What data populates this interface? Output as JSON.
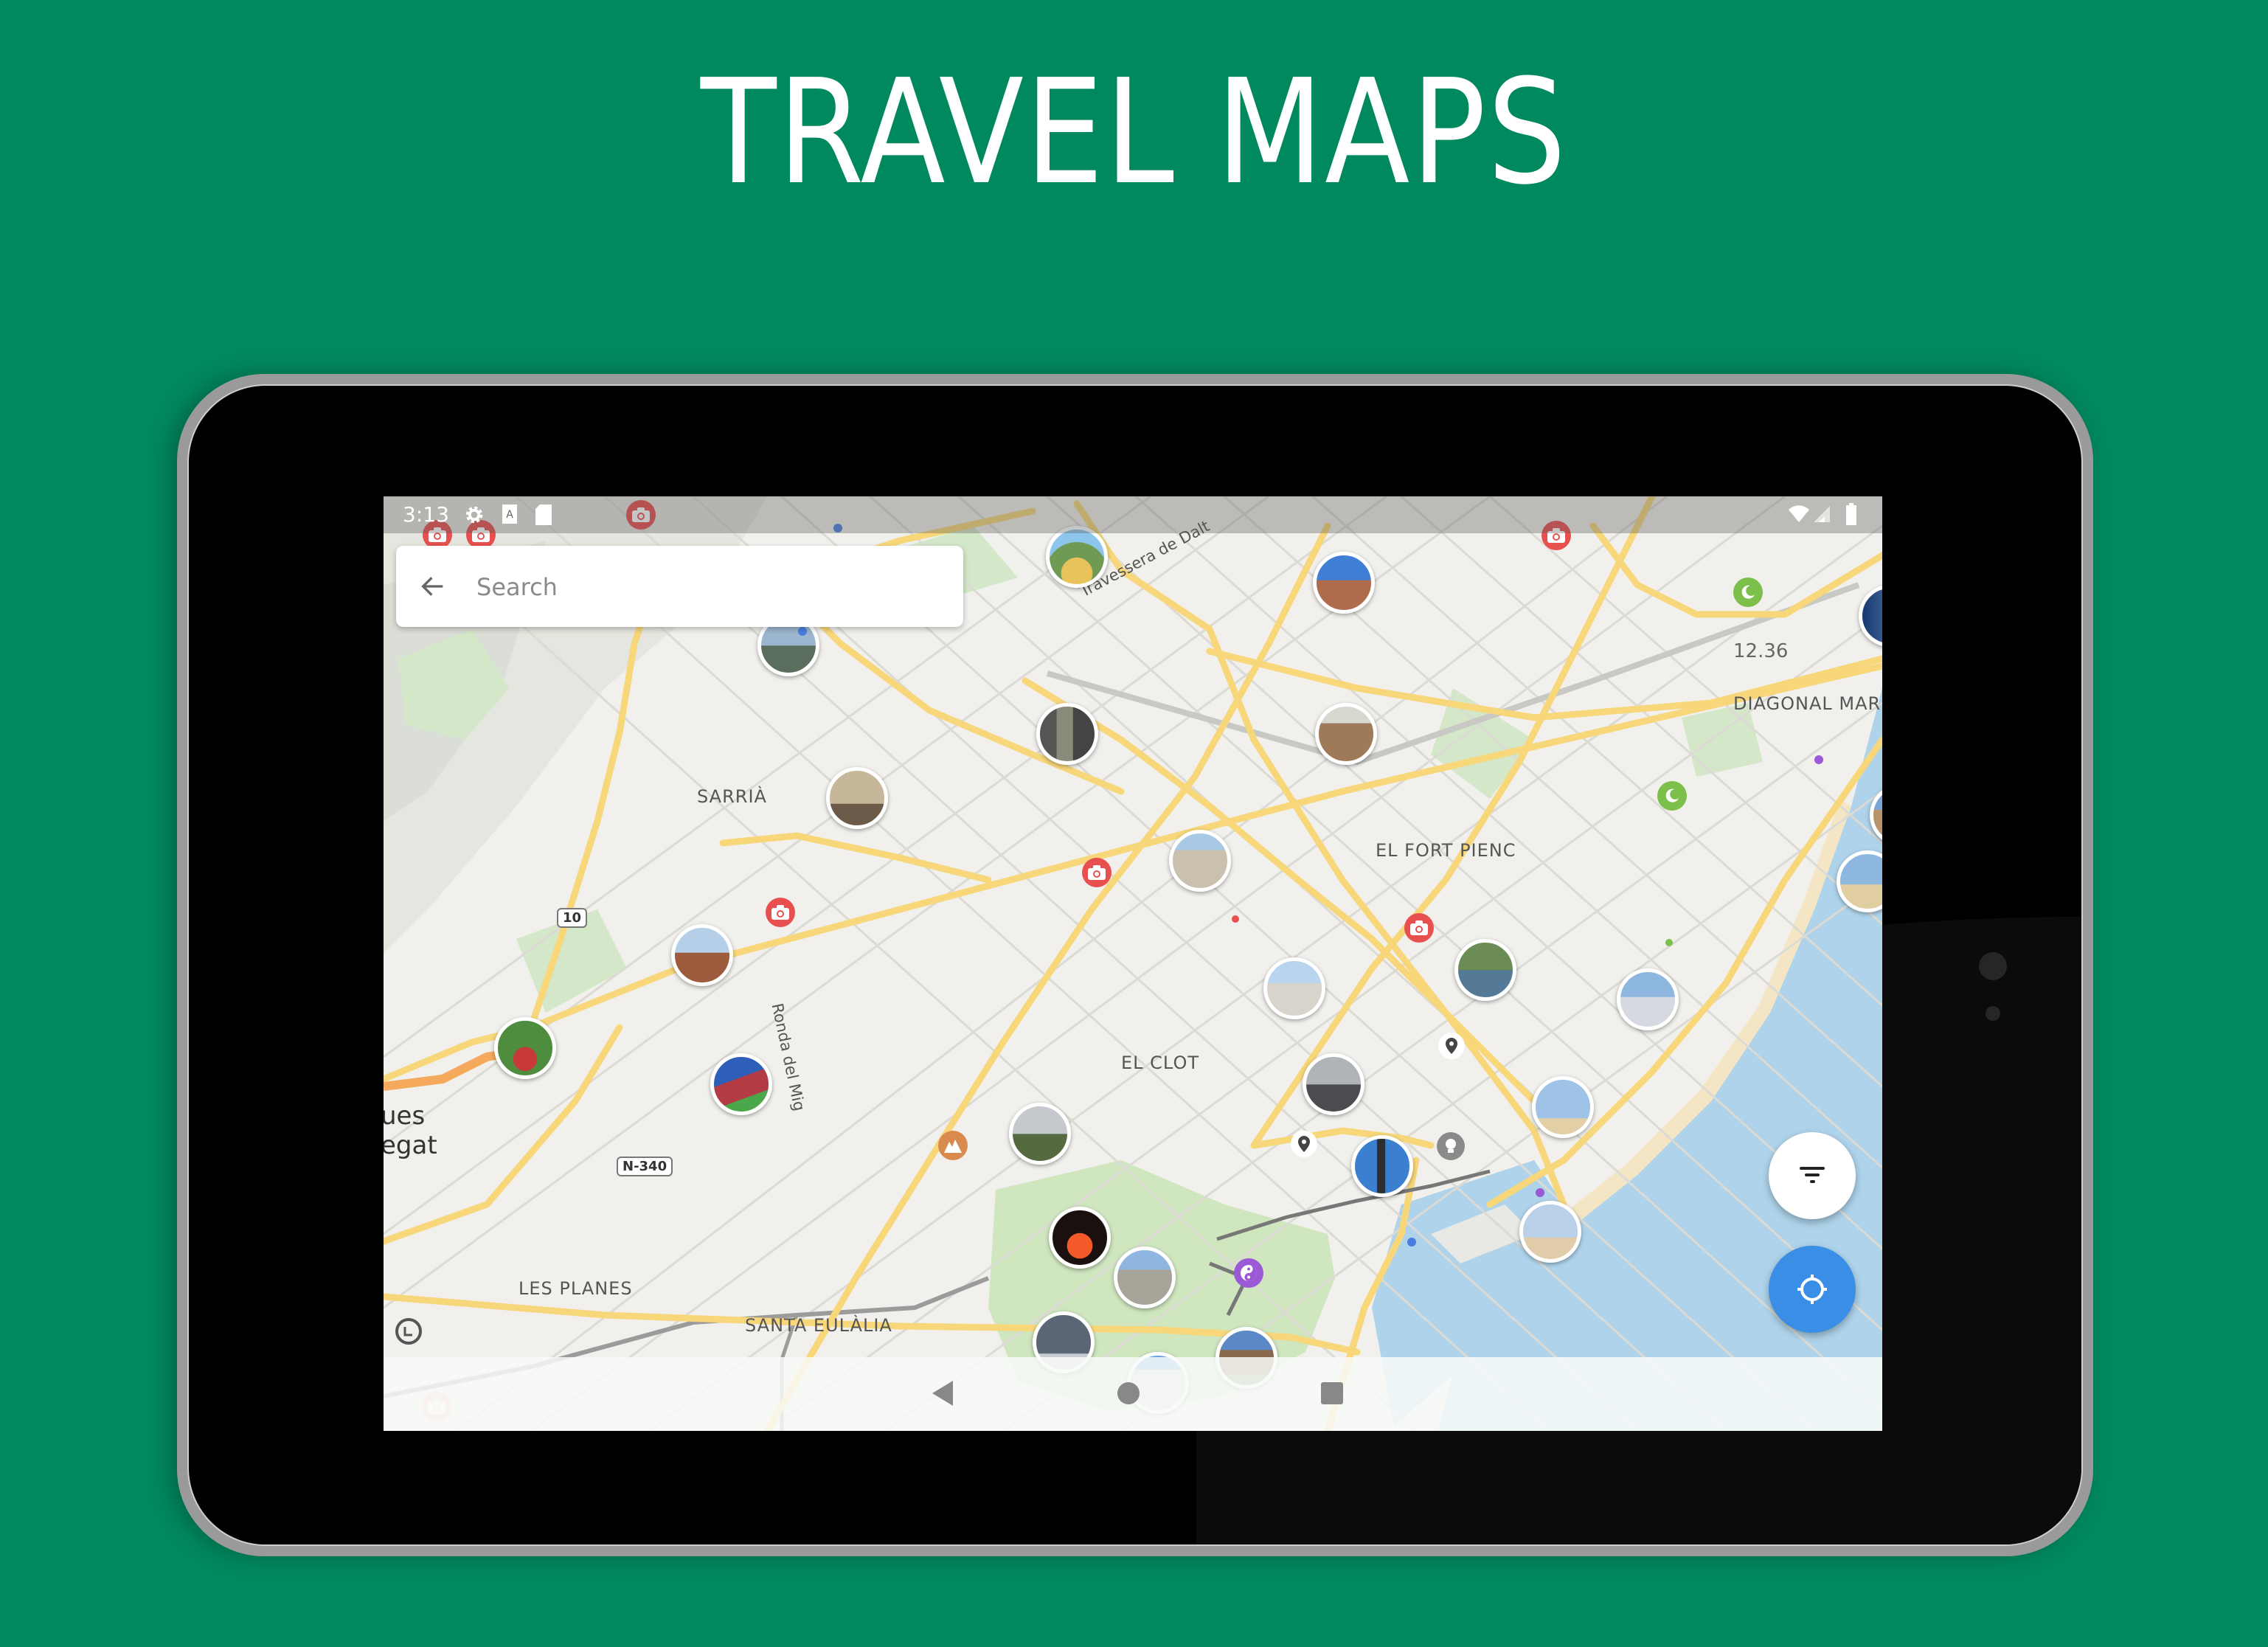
{
  "banner": {
    "title": "TRAVEL MAPS"
  },
  "colors": {
    "background": "#00885f",
    "accent_blue": "#3a8ee6",
    "camera_marker": "#e8504f",
    "park_marker": "#7cbf4a",
    "mountain_marker": "#d98a4e",
    "yin_yang_marker": "#9b59d6",
    "water": "#aed3ea",
    "park": "#cfe8c0",
    "road": "#f7d77a"
  },
  "status_bar": {
    "time": "3:13",
    "left_icons": [
      "settings-icon",
      "keyboard-a-icon",
      "sd-card-icon"
    ],
    "right_icons": [
      "wifi-icon",
      "signal-icon",
      "battery-icon"
    ]
  },
  "search": {
    "placeholder": "Search",
    "value": "",
    "back_icon": "arrow-left-icon"
  },
  "map": {
    "district_labels": [
      {
        "id": "el-clot",
        "text": "EL CLOT"
      },
      {
        "id": "diagonal-mar",
        "text": "DIAGONAL MAR"
      },
      {
        "id": "sarria",
        "text": "SARRIÀ"
      },
      {
        "id": "el-fort-pienc",
        "text": "EL FORT PIENC"
      },
      {
        "id": "les-planes",
        "text": "LES PLANES"
      },
      {
        "id": "santa-eulalia",
        "text": "SANTA EULÀLIA"
      },
      {
        "id": "hospitalet-1",
        "text": "ues"
      },
      {
        "id": "hospitalet-2",
        "text": "egat"
      }
    ],
    "street_labels": [
      {
        "id": "travessera",
        "text": "Travessera de Dalt"
      },
      {
        "id": "ronda-del-mig",
        "text": "Ronda del Mig"
      }
    ],
    "elevation_label": "12.36",
    "road_shields": [
      "10",
      "N-340"
    ],
    "photo_markers": [
      {
        "name": "park-guell"
      },
      {
        "name": "hospital-sant-pau"
      },
      {
        "name": "cathedral-tower"
      },
      {
        "name": "sagrada-familia-facade"
      },
      {
        "name": "sagrada-familia"
      },
      {
        "name": "sarria-building"
      },
      {
        "name": "casa-mila"
      },
      {
        "name": "pedralbes-palace"
      },
      {
        "name": "gardens-flowers"
      },
      {
        "name": "camp-nou-stadium"
      },
      {
        "name": "miro-sculpture"
      },
      {
        "name": "arc-de-triomf"
      },
      {
        "name": "parc-ciutadella"
      },
      {
        "name": "plaza-fountain"
      },
      {
        "name": "columbus-monument"
      },
      {
        "name": "beach-hotel"
      },
      {
        "name": "beach-1"
      },
      {
        "name": "beach-2"
      },
      {
        "name": "port-olimpic"
      },
      {
        "name": "hotel-arts"
      },
      {
        "name": "magic-fountain"
      },
      {
        "name": "montjuic-museum"
      },
      {
        "name": "montjuic-tower"
      },
      {
        "name": "montjuic-castle"
      },
      {
        "name": "poble-espanyol"
      },
      {
        "name": "agbar-tower"
      }
    ]
  },
  "fabs": {
    "filter_icon": "filter-icon",
    "locate_icon": "my-location-icon"
  },
  "nav_bar": {
    "buttons": [
      "back",
      "home",
      "recents"
    ]
  }
}
